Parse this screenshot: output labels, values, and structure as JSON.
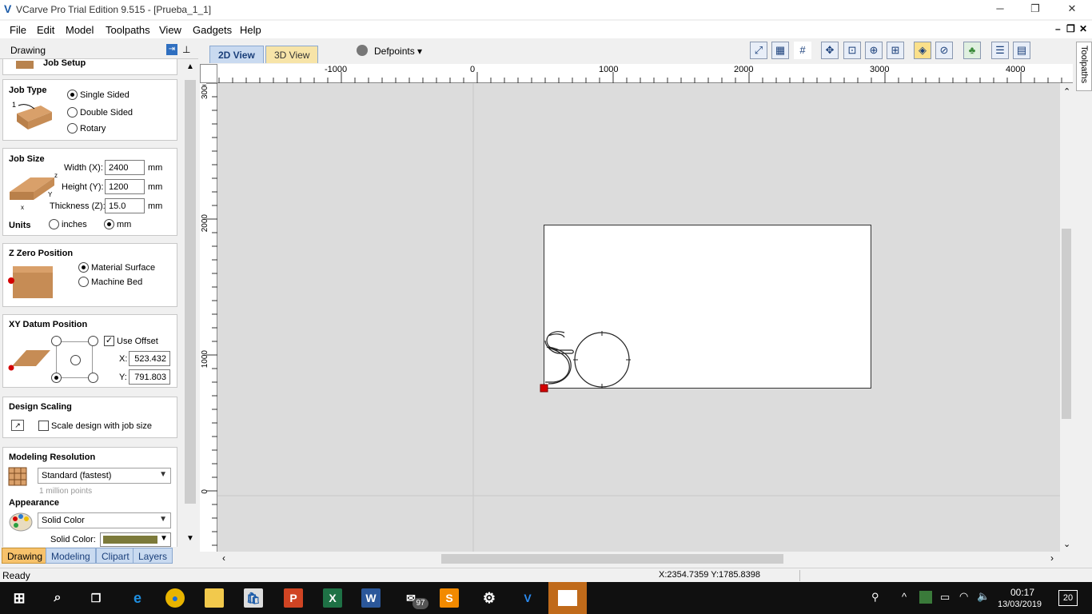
{
  "window": {
    "title": "VCarve Pro Trial Edition 9.515 - [Prueba_1_1]",
    "minimize": "─",
    "restore": "❐",
    "close": "✕"
  },
  "menu": [
    "File",
    "Edit",
    "Model",
    "Toolpaths",
    "View",
    "Gadgets",
    "Help"
  ],
  "panel": {
    "header": "Drawing",
    "job_setup": "Job Setup",
    "job_type": {
      "title": "Job Type",
      "options": [
        "Single Sided",
        "Double Sided",
        "Rotary"
      ],
      "selected": "Single Sided"
    },
    "job_size": {
      "title": "Job Size",
      "width_label": "Width (X):",
      "width": "2400",
      "height_label": "Height (Y):",
      "height": "1200",
      "thickness_label": "Thickness (Z):",
      "thickness": "15.0",
      "unit": "mm",
      "units_label": "Units",
      "unit_inches": "inches",
      "unit_mm": "mm",
      "units_selected": "mm"
    },
    "z_zero": {
      "title": "Z Zero Position",
      "options": [
        "Material Surface",
        "Machine Bed"
      ],
      "selected": "Material Surface"
    },
    "xy_datum": {
      "title": "XY Datum Position",
      "use_offset": "Use Offset",
      "use_offset_checked": true,
      "x_label": "X:",
      "x": "523.432",
      "y_label": "Y:",
      "y": "791.803"
    },
    "design_scaling": {
      "title": "Design Scaling",
      "scale_label": "Scale design with job size",
      "checked": false
    },
    "modeling_resolution": {
      "title": "Modeling Resolution",
      "value": "Standard (fastest)",
      "hint": "1 million points"
    },
    "appearance": {
      "title": "Appearance",
      "value": "Solid Color",
      "solid_color_label": "Solid Color:",
      "solid_color": "#7c7a3a"
    },
    "tabs": [
      "Drawing",
      "Modeling",
      "Clipart",
      "Layers"
    ],
    "active_tab": "Drawing"
  },
  "view": {
    "tabs": [
      "2D View",
      "3D View"
    ],
    "active_tab": "2D View",
    "layer_dropdown": "Defpoints",
    "right_tab": "Toolpaths",
    "ruler_x": [
      "-1000",
      "0",
      "1000",
      "2000",
      "3000",
      "4000"
    ],
    "ruler_y": [
      "3000",
      "2000",
      "1000",
      "0"
    ]
  },
  "status": {
    "left": "Ready",
    "coords": "X:2354.7359 Y:1785.8398"
  },
  "taskbar": {
    "time": "00:17",
    "date": "13/03/2019",
    "mail_badge": "97",
    "notification_count": "20"
  },
  "colors": {
    "accent_tab": "#f7c26b",
    "inactive_tab": "#c9daf0",
    "canvas_bg": "#dcdcdc",
    "datum_marker": "#d40000"
  }
}
